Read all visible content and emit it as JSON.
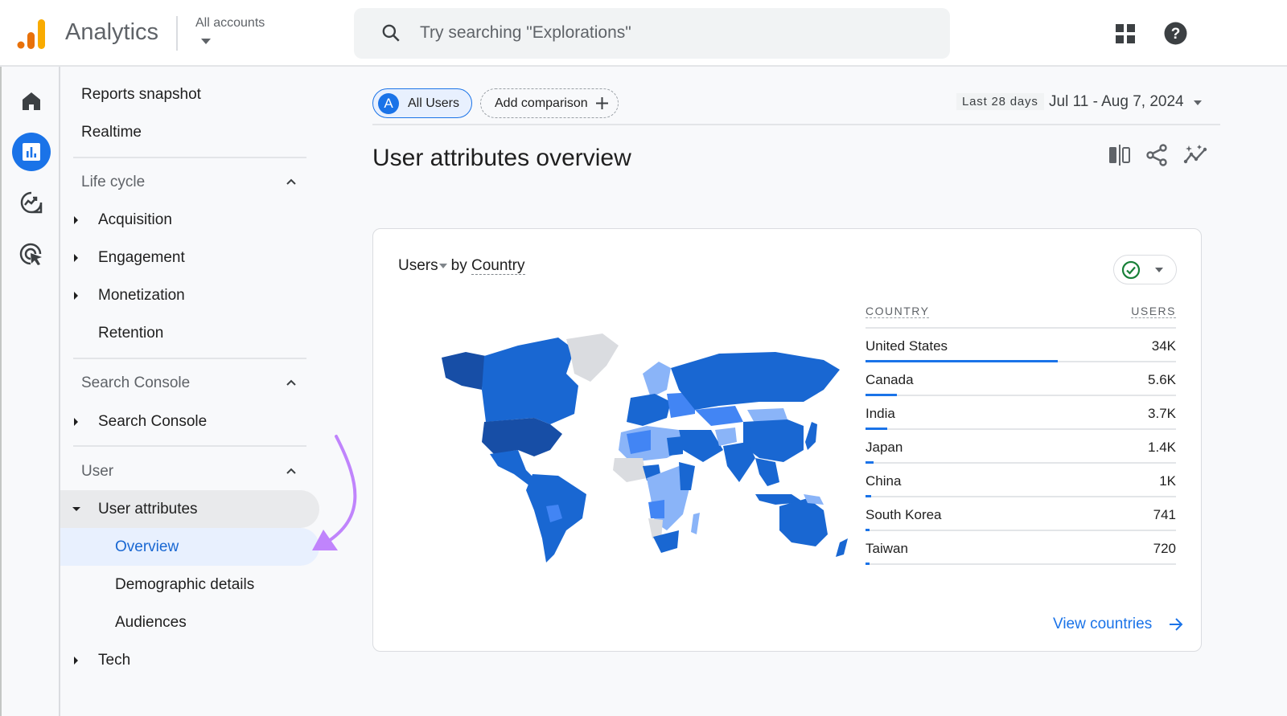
{
  "header": {
    "app_name": "Analytics",
    "account_selector": "All accounts",
    "search_placeholder": "Try searching \"Explorations\""
  },
  "rail": {
    "items": [
      {
        "name": "Home",
        "icon": "home-icon",
        "active": false
      },
      {
        "name": "Reports",
        "icon": "reports-icon",
        "active": true
      },
      {
        "name": "Explore",
        "icon": "explore-icon",
        "active": false
      },
      {
        "name": "Advertising",
        "icon": "advertising-icon",
        "active": false
      }
    ]
  },
  "nav": {
    "reports_snapshot": "Reports snapshot",
    "realtime": "Realtime",
    "life_cycle": {
      "title": "Life cycle",
      "items": [
        "Acquisition",
        "Engagement",
        "Monetization",
        "Retention"
      ]
    },
    "search_console": {
      "title": "Search Console",
      "items": [
        "Search Console"
      ]
    },
    "user": {
      "title": "User",
      "user_attributes": "User attributes",
      "sub_items": [
        "Overview",
        "Demographic details",
        "Audiences"
      ],
      "selected": "Overview",
      "tech": "Tech"
    }
  },
  "toolbar": {
    "segment_avatar": "A",
    "segment_label": "All Users",
    "add_comparison": "Add comparison",
    "date_preset": "Last 28 days",
    "date_range": "Jul 11 - Aug 7, 2024"
  },
  "page": {
    "title": "User attributes overview"
  },
  "card": {
    "metric": "Users",
    "by": "by",
    "dimension": "Country",
    "table": {
      "headers": [
        "COUNTRY",
        "USERS"
      ],
      "rows": [
        {
          "country": "United States",
          "users": "34K",
          "share": 0.62
        },
        {
          "country": "Canada",
          "users": "5.6K",
          "share": 0.1
        },
        {
          "country": "India",
          "users": "3.7K",
          "share": 0.07
        },
        {
          "country": "Japan",
          "users": "1.4K",
          "share": 0.026
        },
        {
          "country": "China",
          "users": "1K",
          "share": 0.018
        },
        {
          "country": "South Korea",
          "users": "741",
          "share": 0.014
        },
        {
          "country": "Taiwan",
          "users": "720",
          "share": 0.013
        }
      ]
    },
    "view_link": "View countries"
  },
  "colors": {
    "accent": "#1a73e8",
    "map_max": "#174ea6",
    "map_high": "#1967d2",
    "map_mid": "#4285f4",
    "map_low": "#8ab4f8",
    "map_none": "#dadce0",
    "annotation": "#c084fc"
  }
}
